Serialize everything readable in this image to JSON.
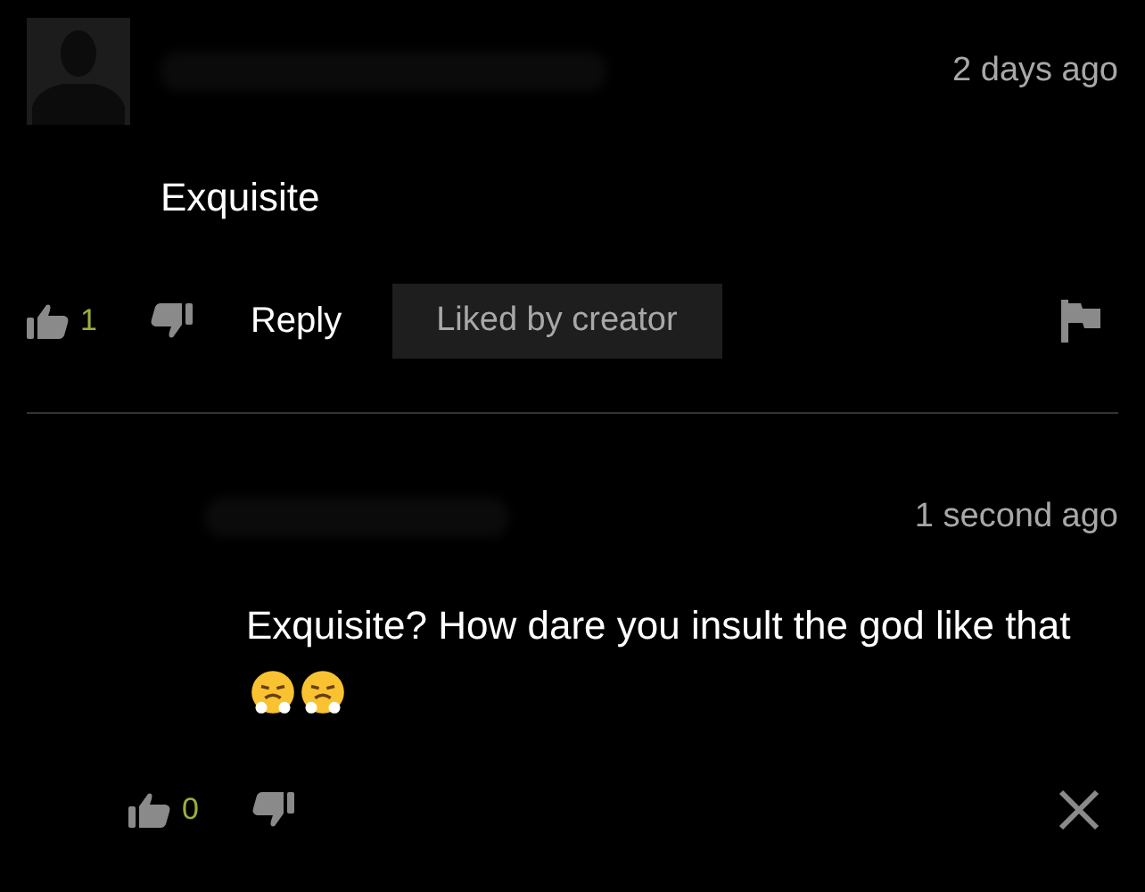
{
  "comments": [
    {
      "kind": "top",
      "time": "2 days ago",
      "body": [
        {
          "kind": "text",
          "text": "Exquisite"
        }
      ],
      "likes": "1",
      "reply_label": "Reply",
      "badge": "Liked by creator",
      "end_button": {
        "kind": "flag"
      }
    },
    {
      "kind": "reply",
      "time": "1 second ago",
      "body": [
        {
          "kind": "text",
          "text": "Exquisite? How dare you insult the god like that"
        },
        {
          "kind": "emoji"
        },
        {
          "kind": "emoji"
        }
      ],
      "likes": "0",
      "end_button": {
        "kind": "close"
      }
    }
  ]
}
